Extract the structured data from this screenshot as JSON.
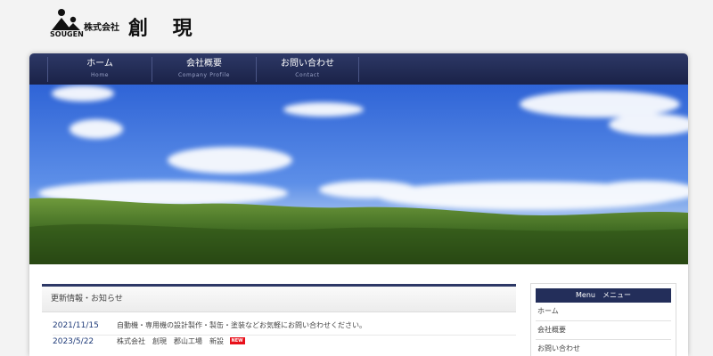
{
  "brand": {
    "company_prefix": "株式会社",
    "name": "創 現",
    "sub": "SOUGEN"
  },
  "nav": {
    "items": [
      {
        "label": "ホーム",
        "sub": "Home"
      },
      {
        "label": "会社概要",
        "sub": "Company Profile"
      },
      {
        "label": "お問い合わせ",
        "sub": "Contact"
      }
    ]
  },
  "news": {
    "title": "更新情報・お知らせ",
    "items": [
      {
        "date": "2021/11/15",
        "text": "自動機・専用機の設計製作・製缶・塗装などお気軽にお問い合わせください。",
        "is_new": false
      },
      {
        "date": "2023/5/22",
        "text": "株式会社　創現　郡山工場　新設",
        "is_new": true,
        "badge": "NEW"
      }
    ]
  },
  "side_menu": {
    "title": "Menu　メニュー",
    "items": [
      "ホーム",
      "会社概要",
      "お問い合わせ"
    ]
  },
  "colors": {
    "nav": "#1f2850",
    "accent": "#2d3866",
    "date": "#1e3a78",
    "new_badge": "#e8101a"
  },
  "icons": {
    "logo": "people-mountain-logo"
  }
}
